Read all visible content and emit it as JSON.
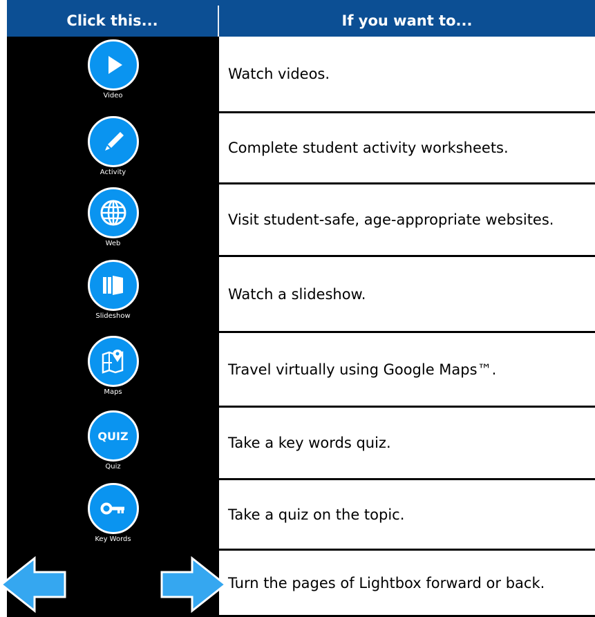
{
  "header": {
    "left_label": "Click this...",
    "right_label": "If you want to..."
  },
  "colors": {
    "header_bg": "#0c4f94",
    "icon_bg": "#000000",
    "icon_blue": "#0a94f0",
    "arrow_blue": "#35a7f0"
  },
  "rows": [
    {
      "icon": "play-icon",
      "label": "Video",
      "description": "Watch videos."
    },
    {
      "icon": "pencil-icon",
      "label": "Activity",
      "description": "Complete student activity worksheets."
    },
    {
      "icon": "globe-icon",
      "label": "Web",
      "description": "Visit student-safe, age-appropriate websites."
    },
    {
      "icon": "slideshow-icon",
      "label": "Slideshow",
      "description": "Watch a slideshow."
    },
    {
      "icon": "map-pin-icon",
      "label": "Maps",
      "description": "Travel virtually using Google Maps™."
    },
    {
      "icon": "quiz-icon",
      "label": "Quiz",
      "icon_text": "QUIZ",
      "description": "Take a key words quiz."
    },
    {
      "icon": "key-icon",
      "label": "Key Words",
      "description": "Take a quiz on the topic."
    },
    {
      "icon": "arrows-icon",
      "description": "Turn the pages of Lightbox forward or back."
    }
  ]
}
